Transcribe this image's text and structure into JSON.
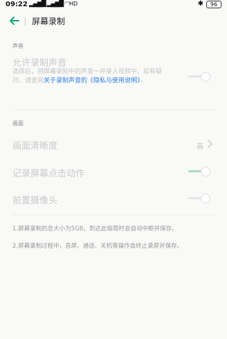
{
  "status_bar": {
    "time": "09:22",
    "signal": "▂▄▆█ ▂▄▆█ ◠",
    "network": "HD",
    "bluetooth": "✱",
    "battery": "96"
  },
  "header": {
    "title": "屏幕录制",
    "back_icon": "arrow-left-icon",
    "accent_color": "#1aa37a"
  },
  "sound_section": {
    "label": "声音",
    "allow_record_title": "允许录制声音",
    "allow_record_desc": "选择后，将屏幕录制中的声音一并录入视频中。如有疑问，请查阅",
    "allow_record_link": "关于录制声音的《隐私与使用说明》",
    "allow_record_suffix": "。",
    "allow_record_enabled": false
  },
  "picture_section": {
    "label": "画面",
    "clarity_title": "画面清晰度",
    "clarity_value": "高",
    "touch_title": "记录屏幕点击动作",
    "touch_enabled": true,
    "front_camera_title": "前置摄像头",
    "front_camera_enabled": false
  },
  "notes": {
    "note1": "1.屏幕录制的总大小为5GB，到达此极限时会自动中断并保存。",
    "note2": "2.屏幕录制过程中，息屏、通话、关机等操作会终止录屏并保存。"
  }
}
